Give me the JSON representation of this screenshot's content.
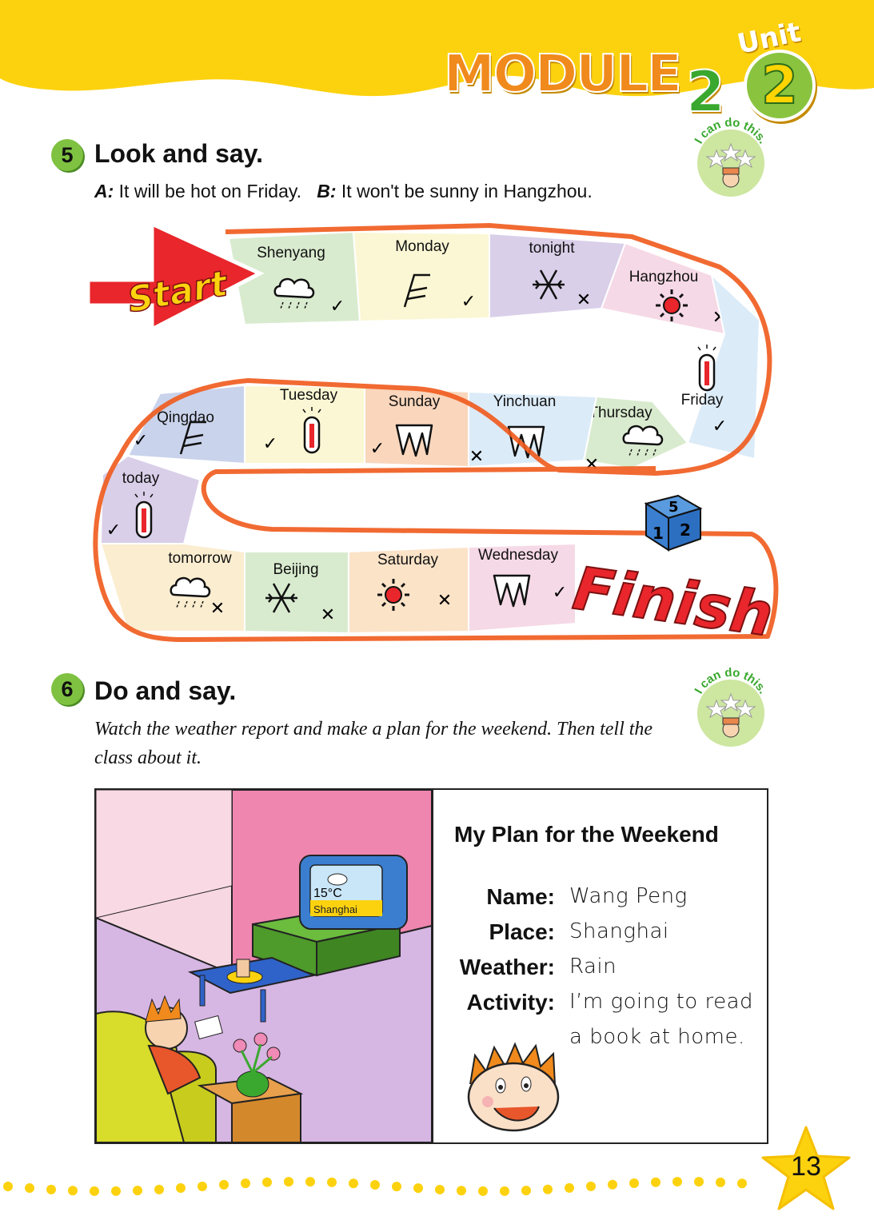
{
  "header": {
    "module_word": "MODULE",
    "module_number": "2",
    "unit_label": "Unit",
    "unit_number": "2",
    "module_letter_colors": [
      "#f08a1c",
      "#4fb845",
      "#e84d8a",
      "#f0c21a",
      "#4fb845",
      "#e84d8a"
    ]
  },
  "badge": {
    "text": "I can do this."
  },
  "section5": {
    "number": "5",
    "title": "Look and say.",
    "example_a_label": "A:",
    "example_a_text": "It will be hot on Friday.",
    "example_b_label": "B:",
    "example_b_text": "It won't be sunny in Hangzhou."
  },
  "board": {
    "start_label": "Start",
    "finish_label": "Finish",
    "dice_faces": [
      "5",
      "1",
      "2"
    ],
    "squares": [
      {
        "label": "Shenyang",
        "icon": "rain-cloud-icon",
        "mark": "✓",
        "color": "#d9ebcf"
      },
      {
        "label": "Monday",
        "icon": "wind-icon",
        "mark": "✓",
        "color": "#fbf7d4"
      },
      {
        "label": "tonight",
        "icon": "snowflake-icon",
        "mark": "✕",
        "color": "#d9cfe9"
      },
      {
        "label": "Hangzhou",
        "icon": "sun-icon",
        "mark": "✕",
        "color": "#f6d9e6"
      },
      {
        "label": "Friday",
        "icon": "thermometer-hot-icon",
        "mark": "✓",
        "color": "#dcebf8"
      },
      {
        "label": "Thursday",
        "icon": "rain-cloud-icon",
        "mark": "✕",
        "color": "#d9ebcf"
      },
      {
        "label": "Yinchuan",
        "icon": "cold-icicle-icon",
        "mark": "✕",
        "color": "#dcebf8"
      },
      {
        "label": "Sunday",
        "icon": "cold-icicle-icon",
        "mark": "✓",
        "color": "#f9d6bc"
      },
      {
        "label": "Tuesday",
        "icon": "thermometer-hot-icon",
        "mark": "✓",
        "color": "#fbf7d4"
      },
      {
        "label": "Qingdao",
        "icon": "wind-icon",
        "mark": "✓",
        "color": "#c9d3eb"
      },
      {
        "label": "today",
        "icon": "thermometer-hot-icon",
        "mark": "✓",
        "color": "#d9cfe9"
      },
      {
        "label": "tomorrow",
        "icon": "rain-cloud-icon",
        "mark": "✕",
        "color": "#fbedd0"
      },
      {
        "label": "Beijing",
        "icon": "snowflake-icon",
        "mark": "✕",
        "color": "#d9ebcf"
      },
      {
        "label": "Saturday",
        "icon": "sun-icon",
        "mark": "✕",
        "color": "#fbe3c8"
      },
      {
        "label": "Wednesday",
        "icon": "cold-icicle-icon",
        "mark": "✓",
        "color": "#f6d9e6"
      }
    ]
  },
  "section6": {
    "number": "6",
    "title": "Do and say.",
    "instruction": "Watch the weather report and make a plan for the weekend. Then tell the class about it."
  },
  "tv": {
    "temperature": "15°C",
    "city": "Shanghai"
  },
  "plan": {
    "title": "My Plan for the Weekend",
    "rows": [
      {
        "key": "Name:",
        "value": "Wang Peng"
      },
      {
        "key": "Place:",
        "value": "Shanghai"
      },
      {
        "key": "Weather:",
        "value": "Rain"
      },
      {
        "key": "Activity:",
        "value": "I’m going to read"
      },
      {
        "key": "",
        "value": "a book at home."
      }
    ]
  },
  "page_number": "13"
}
